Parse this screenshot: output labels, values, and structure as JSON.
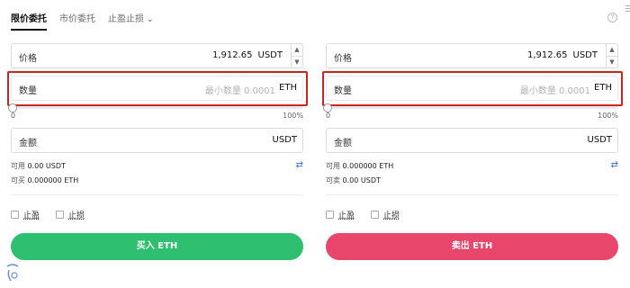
{
  "tabs": [
    {
      "label": "限价委托",
      "active": true
    },
    {
      "label": "市价委托",
      "active": false
    },
    {
      "label": "止盈止损",
      "active": false,
      "has_dropdown": true
    }
  ],
  "buy": {
    "price_label": "价格",
    "price_value": "1,912.65",
    "price_unit": "USDT",
    "qty_label": "数量",
    "qty_placeholder": "最小数量 0.0001",
    "qty_unit": "ETH",
    "slider_min": "0",
    "slider_max": "100%",
    "slider_value_percent": 0,
    "amount_label": "金额",
    "amount_unit": "USDT",
    "available_label": "可用",
    "available_value": "0.00 USDT",
    "can_buy_label": "可买",
    "can_buy_value": "0.000000 ETH",
    "take_profit_label": "止盈",
    "stop_loss_label": "止损",
    "action_label": "买入 ETH"
  },
  "sell": {
    "price_label": "价格",
    "price_value": "1,912.65",
    "price_unit": "USDT",
    "qty_label": "数量",
    "qty_placeholder": "最小数量 0.0001",
    "qty_unit": "ETH",
    "slider_min": "0",
    "slider_max": "100%",
    "slider_value_percent": 0,
    "amount_label": "金额",
    "amount_unit": "USDT",
    "available_label": "可用",
    "available_value": "0.000000 ETH",
    "can_sell_label": "可卖",
    "can_sell_value": "0.00 USDT",
    "take_profit_label": "止盈",
    "stop_loss_label": "止损",
    "action_label": "卖出 ETH"
  },
  "icons": {
    "help": "help-icon",
    "swap": "swap-arrows-icon",
    "chevron": "chevron-down-icon"
  },
  "colors": {
    "buy": "#2fbf71",
    "sell": "#e8466a",
    "highlight": "#c8261f",
    "swap": "#2f6fd8"
  }
}
